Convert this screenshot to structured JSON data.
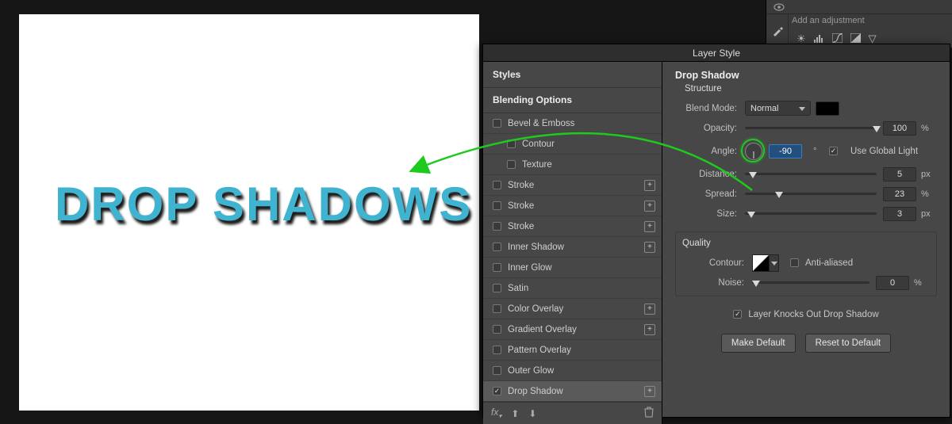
{
  "canvas": {
    "text": "DROP SHADOWS"
  },
  "adjustments": {
    "header": "Add an adjustment"
  },
  "dialog": {
    "title": "Layer Style",
    "styles_header": "Styles",
    "blending_options": "Blending Options",
    "items": [
      {
        "label": "Bevel & Emboss",
        "checked": false
      },
      {
        "label": "Contour",
        "checked": false,
        "sub": true
      },
      {
        "label": "Texture",
        "checked": false,
        "sub": true
      },
      {
        "label": "Stroke",
        "checked": false,
        "plus": true
      },
      {
        "label": "Stroke",
        "checked": false,
        "plus": true
      },
      {
        "label": "Stroke",
        "checked": false,
        "plus": true
      },
      {
        "label": "Inner Shadow",
        "checked": false,
        "plus": true
      },
      {
        "label": "Inner Glow",
        "checked": false
      },
      {
        "label": "Satin",
        "checked": false
      },
      {
        "label": "Color Overlay",
        "checked": false,
        "plus": true
      },
      {
        "label": "Gradient Overlay",
        "checked": false,
        "plus": true
      },
      {
        "label": "Pattern Overlay",
        "checked": false
      },
      {
        "label": "Outer Glow",
        "checked": false
      },
      {
        "label": "Drop Shadow",
        "checked": true,
        "plus": true,
        "selected": true
      }
    ],
    "fx_label": "fx"
  },
  "settings": {
    "section": "Drop Shadow",
    "structure": "Structure",
    "blend_mode_label": "Blend Mode:",
    "blend_mode_value": "Normal",
    "opacity_label": "Opacity:",
    "opacity_value": "100",
    "opacity_unit": "%",
    "angle_label": "Angle:",
    "angle_value": "-90",
    "angle_unit": "°",
    "use_global_light": "Use Global Light",
    "distance_label": "Distance:",
    "distance_value": "5",
    "distance_unit": "px",
    "spread_label": "Spread:",
    "spread_value": "23",
    "spread_unit": "%",
    "size_label": "Size:",
    "size_value": "3",
    "size_unit": "px",
    "quality": "Quality",
    "contour_label": "Contour:",
    "anti_aliased": "Anti-aliased",
    "noise_label": "Noise:",
    "noise_value": "0",
    "noise_unit": "%",
    "knockout": "Layer Knocks Out Drop Shadow",
    "make_default": "Make Default",
    "reset_default": "Reset to Default"
  }
}
